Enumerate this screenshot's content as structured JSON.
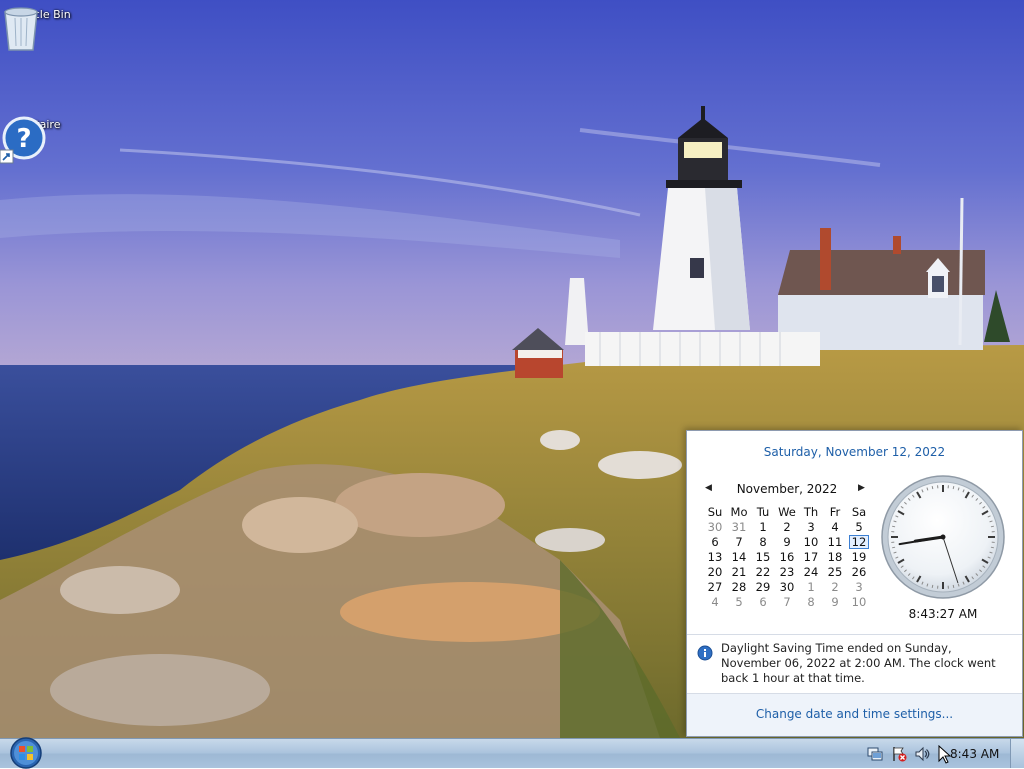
{
  "desktop": {
    "icons": [
      {
        "label": "Recycle Bin"
      },
      {
        "label": "Solitaire"
      }
    ]
  },
  "flyout": {
    "long_date": "Saturday, November 12, 2022",
    "month_title": "November, 2022",
    "weekdays": [
      "Su",
      "Mo",
      "Tu",
      "We",
      "Th",
      "Fr",
      "Sa"
    ],
    "weeks": [
      [
        "30",
        "31",
        "1",
        "2",
        "3",
        "4",
        "5"
      ],
      [
        "6",
        "7",
        "8",
        "9",
        "10",
        "11",
        "12"
      ],
      [
        "13",
        "14",
        "15",
        "16",
        "17",
        "18",
        "19"
      ],
      [
        "20",
        "21",
        "22",
        "23",
        "24",
        "25",
        "26"
      ],
      [
        "27",
        "28",
        "29",
        "30",
        "1",
        "2",
        "3"
      ],
      [
        "4",
        "5",
        "6",
        "7",
        "8",
        "9",
        "10"
      ]
    ],
    "today": "12",
    "analog_time": {
      "hour": 8,
      "minute": 43,
      "second": 27
    },
    "digital_time": "8:43:27 AM",
    "dst_note": "Daylight Saving Time ended on Sunday, November 06, 2022 at 2:00 AM. The clock went back 1 hour at that time.",
    "settings_link": "Change date and time settings..."
  },
  "taskbar": {
    "tray_time": "8:43 AM",
    "tray_icons": [
      "network-icon",
      "action-center-flag-icon",
      "volume-icon"
    ]
  },
  "colors": {
    "link": "#1e5fa8",
    "today_highlight": "#3c7fd2",
    "taskbar": "#a9c2dc"
  }
}
